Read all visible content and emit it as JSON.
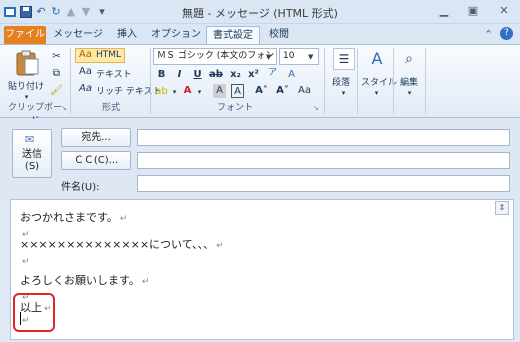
{
  "window": {
    "title": "無題 - メッセージ (HTML 形式)",
    "minimize_icon": "minimize-icon",
    "maximize_icon": "maximize-icon",
    "close_icon": "close-icon"
  },
  "tabs": [
    {
      "label": "ファイル"
    },
    {
      "label": "メッセージ"
    },
    {
      "label": "挿入"
    },
    {
      "label": "オプション"
    },
    {
      "label": "書式設定"
    },
    {
      "label": "校閲"
    }
  ],
  "active_tab": "書式設定",
  "ribbon": {
    "clipboard": {
      "paste_label": "貼り付け",
      "group_label": "クリップボード"
    },
    "format": {
      "html_label": "HTML",
      "text_label": "テキスト",
      "rich_label": "リッチ テキスト",
      "group_label": "形式",
      "html_prefix": "Aa",
      "text_prefix": "Aa",
      "rich_prefix": "Aa"
    },
    "font": {
      "font_name": "ＭＳ ゴシック (本文のフォント・",
      "font_size": "10",
      "group_label": "フォント"
    },
    "paragraph": {
      "label": "段落"
    },
    "style": {
      "label": "スタイル"
    },
    "edit": {
      "label": "編集"
    }
  },
  "colors": {
    "file_tab": "#e4801f",
    "highlight": "#e0242a",
    "accent": "#1e395b"
  },
  "header": {
    "send_label": "送信\n(S)",
    "to_button": "宛先...",
    "cc_button": "ＣＣ(C)...",
    "subject_label": "件名(U):",
    "to_value": "",
    "cc_value": "",
    "subject_value": ""
  },
  "body": {
    "lines": [
      "おつかれさまです。",
      "",
      "××××××××××××××について、、、",
      "",
      "よろしくお願いします。",
      "",
      "以上",
      ""
    ],
    "paragraph_mark": "↵"
  }
}
